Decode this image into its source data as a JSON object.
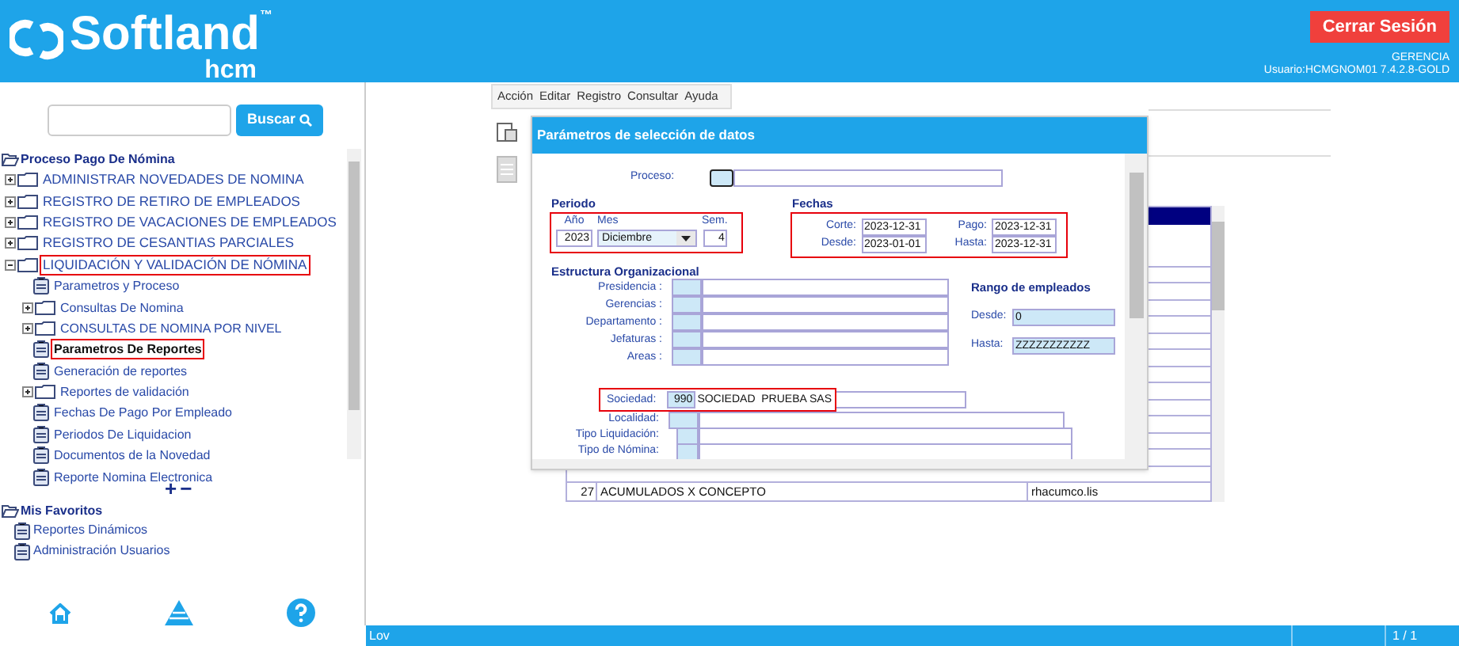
{
  "header": {
    "logo_text": "Softland",
    "logo_tm": "™",
    "logo_sub": "hcm",
    "logout_button": "Cerrar Sesión",
    "company": "GERENCIA",
    "user": "Usuario:HCMGNOM01 7.4.2.8-GOLD"
  },
  "sidebar": {
    "search_button": "Buscar",
    "tree": {
      "label": "Proceso Pago De Nómina",
      "children": [
        {
          "label": "ADMINISTRAR NOVEDADES DE NOMINA",
          "kind": "folder",
          "expanded": false,
          "highlighted": false
        },
        {
          "label": "REGISTRO DE RETIRO DE EMPLEADOS",
          "kind": "folder",
          "expanded": false,
          "highlighted": false
        },
        {
          "label": "REGISTRO DE VACACIONES DE EMPLEADOS",
          "kind": "folder",
          "expanded": false,
          "highlighted": false
        },
        {
          "label": "REGISTRO DE CESANTIAS PARCIALES",
          "kind": "folder",
          "expanded": false,
          "highlighted": false
        },
        {
          "label": "LIQUIDACIÓN Y VALIDACIÓN DE NÓMINA",
          "kind": "folder",
          "expanded": true,
          "highlighted": true,
          "children": [
            {
              "label": "Parametros y Proceso",
              "kind": "doc",
              "highlighted": false
            },
            {
              "label": "Consultas De Nomina",
              "kind": "folder",
              "expanded": false,
              "highlighted": false
            },
            {
              "label": "CONSULTAS DE NOMINA POR NIVEL",
              "kind": "folder",
              "expanded": false,
              "highlighted": false
            },
            {
              "label": "Parametros De Reportes",
              "kind": "doc",
              "highlighted": true
            },
            {
              "label": "Generación de reportes",
              "kind": "doc",
              "highlighted": false
            },
            {
              "label": "Reportes de validación",
              "kind": "folder",
              "expanded": false,
              "highlighted": false
            },
            {
              "label": "Fechas De Pago Por Empleado",
              "kind": "doc",
              "highlighted": false
            },
            {
              "label": "Periodos De Liquidacion",
              "kind": "doc",
              "highlighted": false
            },
            {
              "label": "Documentos de la Novedad",
              "kind": "doc",
              "highlighted": false
            },
            {
              "label": "Reporte Nomina Electronica",
              "kind": "doc",
              "highlighted": false
            }
          ]
        }
      ]
    },
    "zoom_in": "+",
    "zoom_out": "−",
    "favorites": {
      "label": "Mis Favoritos",
      "children": [
        {
          "label": "Reportes Dinámicos",
          "highlighted": false
        },
        {
          "label": "Administración Usuarios",
          "highlighted": false
        }
      ]
    }
  },
  "menu_bar": [
    "Acción",
    "Editar",
    "Registro",
    "Consultar",
    "Ayuda"
  ],
  "dialog": {
    "title": "Parámetros de selección de datos",
    "proceso": {
      "label": "Proceso:"
    },
    "periodo": {
      "title": "Periodo",
      "highlighted": true,
      "year_label": "Año",
      "year": "2023",
      "month_label": "Mes",
      "month": "Diciembre",
      "week_label": "Sem.",
      "week": "4"
    },
    "fechas": {
      "title": "Fechas",
      "highlighted": true,
      "fields": [
        {
          "label": "Corte:",
          "value": "2023-12-31"
        },
        {
          "label": "Pago:",
          "value": "2023-12-31"
        },
        {
          "label": "Desde:",
          "value": "2023-01-01"
        },
        {
          "label": "Hasta:",
          "value": "2023-12-31"
        }
      ]
    },
    "estructura": {
      "title": "Estructura Organizacional",
      "fields": [
        {
          "label": "Presidencia :"
        },
        {
          "label": "Gerencias :"
        },
        {
          "label": "Departamento :"
        },
        {
          "label": "Jefaturas :"
        },
        {
          "label": "Areas :"
        }
      ]
    },
    "rango": {
      "title": "Rango de empleados",
      "from_label": "Desde:",
      "from": "0",
      "to_label": "Hasta:",
      "to": "ZZZZZZZZZZZ"
    },
    "sociedad": {
      "label": "Sociedad:",
      "code": "990",
      "name": "SOCIEDAD  PRUEBA SAS",
      "highlighted": true
    },
    "other_fields": [
      {
        "label": "Localidad:"
      },
      {
        "label": "Tipo Liquidación:"
      },
      {
        "label": "Tipo de Nómina:"
      }
    ]
  },
  "background_table": {
    "rows": [
      {
        "number": "27",
        "description": "ACUMULADOS X CONCEPTO",
        "file": "rhacumco.lis"
      }
    ]
  },
  "status_bar": {
    "left": "Lov",
    "page": "1 / 1"
  }
}
